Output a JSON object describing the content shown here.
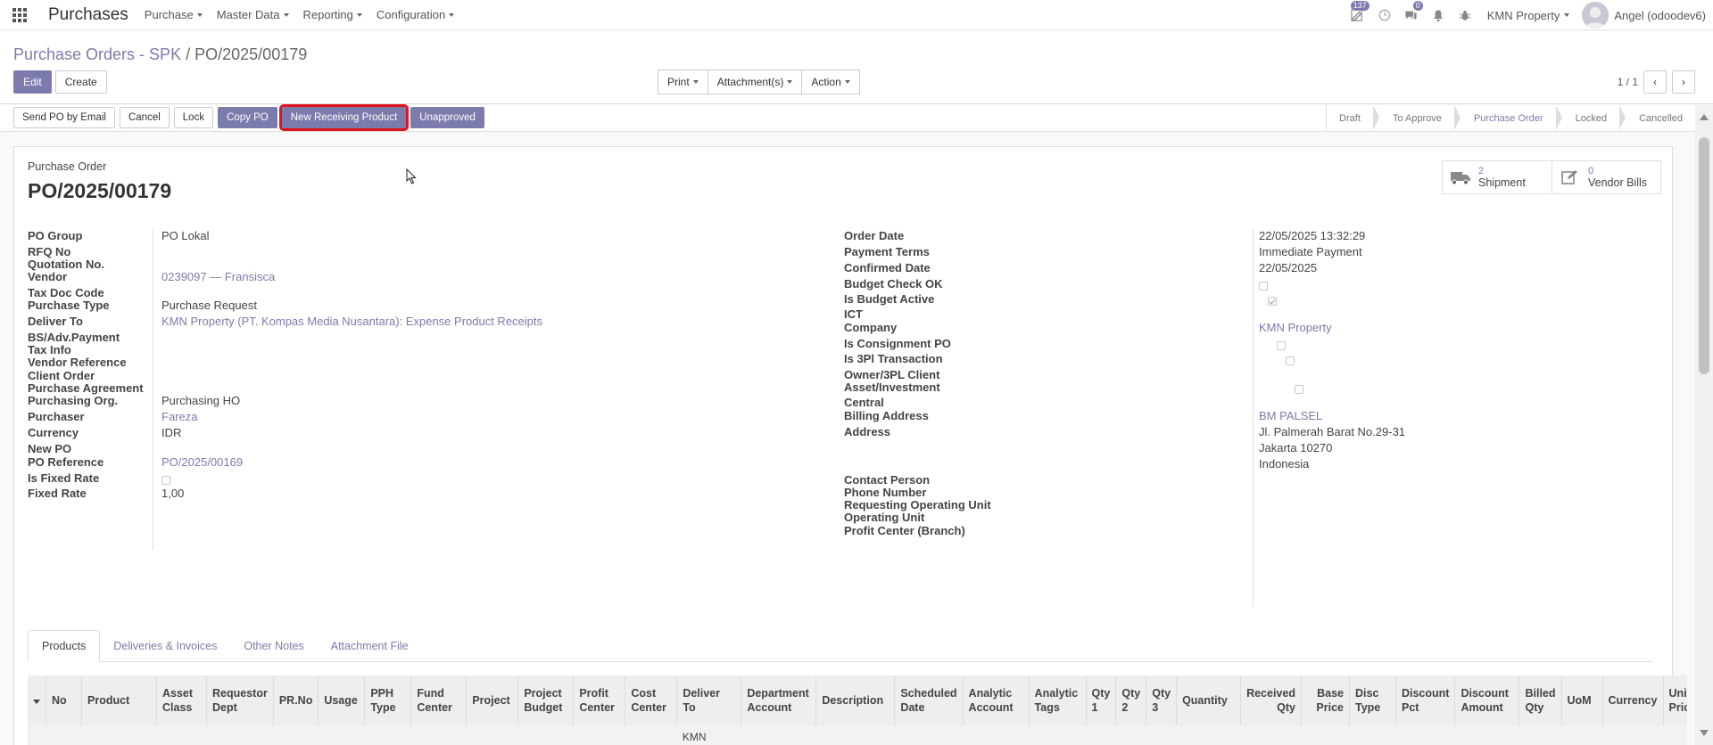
{
  "navbar": {
    "app_name": "Purchases",
    "menus": [
      "Purchase",
      "Master Data",
      "Reporting",
      "Configuration"
    ],
    "activity_badge": "137",
    "messages_badge": "0",
    "company": "KMN Property",
    "user": "Angel (odoodev6)"
  },
  "breadcrumb": {
    "parent": "Purchase Orders - SPK",
    "separator": "/",
    "current": "PO/2025/00179"
  },
  "control": {
    "edit": "Edit",
    "create": "Create",
    "print": "Print",
    "attachments": "Attachment(s)",
    "action": "Action",
    "pager": "1 / 1"
  },
  "header_buttons": {
    "send_email": "Send PO by Email",
    "cancel": "Cancel",
    "lock": "Lock",
    "copy_po": "Copy PO",
    "new_receiving": "New Receiving Product",
    "unapproved": "Unapproved"
  },
  "stages": [
    "Draft",
    "To Approve",
    "Purchase Order",
    "Locked",
    "Cancelled"
  ],
  "active_stage": "Purchase Order",
  "form": {
    "doc_type": "Purchase Order",
    "name": "PO/2025/00179",
    "smart": {
      "shipment_count": "2",
      "shipment_label": "Shipment",
      "bills_count": "0",
      "bills_label": "Vendor Bills"
    },
    "left_fields": [
      {
        "label": "PO Group",
        "value": "PO Lokal",
        "link": false
      },
      {
        "label": "RFQ No",
        "value": "",
        "link": false
      },
      {
        "label": "Quotation No.",
        "value": "",
        "link": false
      },
      {
        "label": "Vendor",
        "value": "0239097 — Fransisca",
        "link": true
      },
      {
        "label": "Tax Doc Code",
        "value": "",
        "link": false
      },
      {
        "label": "Purchase Type",
        "value": "Purchase Request",
        "link": false
      },
      {
        "label": "Deliver To",
        "value": "KMN Property (PT. Kompas Media Nusantara): Expense Product Receipts",
        "link": true
      },
      {
        "label": "BS/Adv.Payment",
        "value": "",
        "link": false
      },
      {
        "label": "Tax Info",
        "value": "",
        "link": false
      },
      {
        "label": "Vendor Reference",
        "value": "",
        "link": false
      },
      {
        "label": "Client Order",
        "value": "",
        "link": false
      },
      {
        "label": "Purchase Agreement",
        "value": "",
        "link": false
      },
      {
        "label": "Purchasing Org.",
        "value": "Purchasing HO",
        "link": false
      },
      {
        "label": "Purchaser",
        "value": "Fareza",
        "link": true
      },
      {
        "label": "Currency",
        "value": "IDR",
        "link": false
      },
      {
        "label": "New PO",
        "value": "",
        "link": false
      },
      {
        "label": "PO Reference",
        "value": "PO/2025/00169",
        "link": true
      },
      {
        "label": "Is Fixed Rate",
        "value": "checkbox",
        "link": false
      },
      {
        "label": "Fixed Rate",
        "value": "1,00",
        "link": false
      }
    ],
    "right_fields": [
      {
        "label": "Order Date",
        "value": "22/05/2025 13:32:29",
        "link": false
      },
      {
        "label": "Payment Terms",
        "value": "Immediate Payment",
        "link": false
      },
      {
        "label": "Confirmed Date",
        "value": "22/05/2025",
        "link": false
      },
      {
        "label": "Budget Check OK",
        "value": "checkbox",
        "link": false
      },
      {
        "label": "Is Budget Active",
        "value": "checkbox-checked",
        "link": false
      },
      {
        "label": "ICT",
        "value": "",
        "link": false
      },
      {
        "label": "Company",
        "value": "KMN Property",
        "link": true
      },
      {
        "label": "Is Consignment PO",
        "value": "checkbox",
        "link": false
      },
      {
        "label": "Is 3Pl Transaction",
        "value": "checkbox",
        "link": false
      },
      {
        "label": "Owner/3PL Client",
        "value": "",
        "link": false
      },
      {
        "label": "Asset/Investment",
        "value": "checkbox",
        "link": false
      },
      {
        "label": "Central",
        "value": "",
        "link": false
      },
      {
        "label": "Billing Address",
        "value": "BM PALSEL",
        "link": true
      },
      {
        "label": "Address",
        "value": "Jl. Palmerah Barat No.29-31",
        "link": false
      },
      {
        "label": "",
        "value": "Jakarta  10270",
        "link": false
      },
      {
        "label": "",
        "value": "Indonesia",
        "link": false
      },
      {
        "label": "Contact Person",
        "value": "",
        "link": false
      },
      {
        "label": "Phone Number",
        "value": "",
        "link": false
      },
      {
        "label": "Requesting Operating Unit",
        "value": "",
        "link": false
      },
      {
        "label": "Operating Unit",
        "value": "",
        "link": false
      },
      {
        "label": "Profit Center (Branch)",
        "value": "",
        "link": false
      }
    ]
  },
  "tabs": [
    "Products",
    "Deliveries & Invoices",
    "Other Notes",
    "Attachment File"
  ],
  "table": {
    "columns": [
      "No",
      "Product",
      "Asset Class",
      "Requestor Dept",
      "PR.No",
      "Usage",
      "PPH Type",
      "Fund Center",
      "Project",
      "Project Budget",
      "Profit Center",
      "Cost Center",
      "Deliver To",
      "Department Account",
      "Description",
      "Scheduled Date",
      "Analytic Account",
      "Analytic Tags",
      "Qty 1",
      "Qty 2",
      "Qty 3",
      "Quantity",
      "Received Qty",
      "Base Price",
      "Disc Type",
      "Discount Pct",
      "Discount Amount",
      "Billed Qty",
      "UoM",
      "Currency",
      "Unit Price"
    ],
    "first_row_deliver_to": "KMN"
  }
}
